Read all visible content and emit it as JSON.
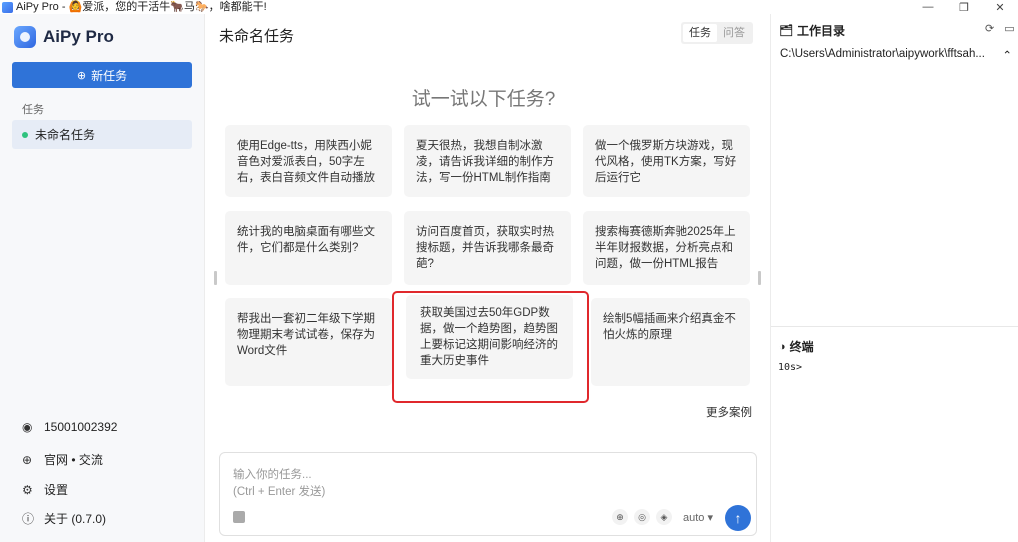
{
  "window": {
    "title": "AiPy Pro - 🙆爱派，您的干活牛🐂马🐎，啥都能干!",
    "controls": [
      "—",
      "❐",
      "✕"
    ]
  },
  "sidebar": {
    "logo_text": "AiPy Pro",
    "new_task_label": "新任务",
    "section_label": "任务",
    "tasks": [
      {
        "label": "未命名任务"
      }
    ],
    "footer": {
      "account": "15001002392",
      "site_links": "官网 • 交流",
      "settings": "设置",
      "about": "关于  (0.7.0)"
    }
  },
  "main": {
    "title": "未命名任务",
    "tabs": [
      {
        "label": "任务",
        "active": true
      },
      {
        "label": "问答",
        "active": false
      }
    ],
    "try_heading": "试一试以下任务?",
    "cards": [
      {
        "text": "使用Edge-tts，用陕西小妮音色对爱派表白，50字左右，表白音频文件自动播放"
      },
      {
        "text": "夏天很热，我想自制冰激凌，请告诉我详细的制作方法，写一份HTML制作指南"
      },
      {
        "text": "做一个俄罗斯方块游戏，现代风格，使用TK方案，写好后运行它"
      },
      {
        "text": "统计我的电脑桌面有哪些文件，它们都是什么类别?"
      },
      {
        "text": "访问百度首页，获取实时热搜标题，并告诉我哪条最奇葩?"
      },
      {
        "text": "搜索梅赛德斯奔驰2025年上半年财报数据，分析亮点和问题，做一份HTML报告"
      },
      {
        "text": "帮我出一套初二年级下学期物理期末考试试卷，保存为Word文件"
      },
      {
        "text": "获取美国过去50年GDP数据，做一个趋势图，趋势图上要标记这期间影响经济的重大历史事件"
      },
      {
        "text": "绘制5幅插画来介绍真金不怕火炼的原理"
      }
    ],
    "more_label": "更多案例",
    "input": {
      "placeholder_line1": "输入你的任务...",
      "placeholder_line2": "(Ctrl + Enter 发送)",
      "model": "auto ▾"
    }
  },
  "right_panel": {
    "workdir_title": "工作目录",
    "workdir_path": "C:\\Users\\Administrator\\aipywork\\fftsah...",
    "terminal_title": "终端",
    "terminal_text": "10s>"
  },
  "colors": {
    "accent": "#2f73d8",
    "highlight_border": "#e0282c",
    "status_dot": "#2ec27e"
  }
}
